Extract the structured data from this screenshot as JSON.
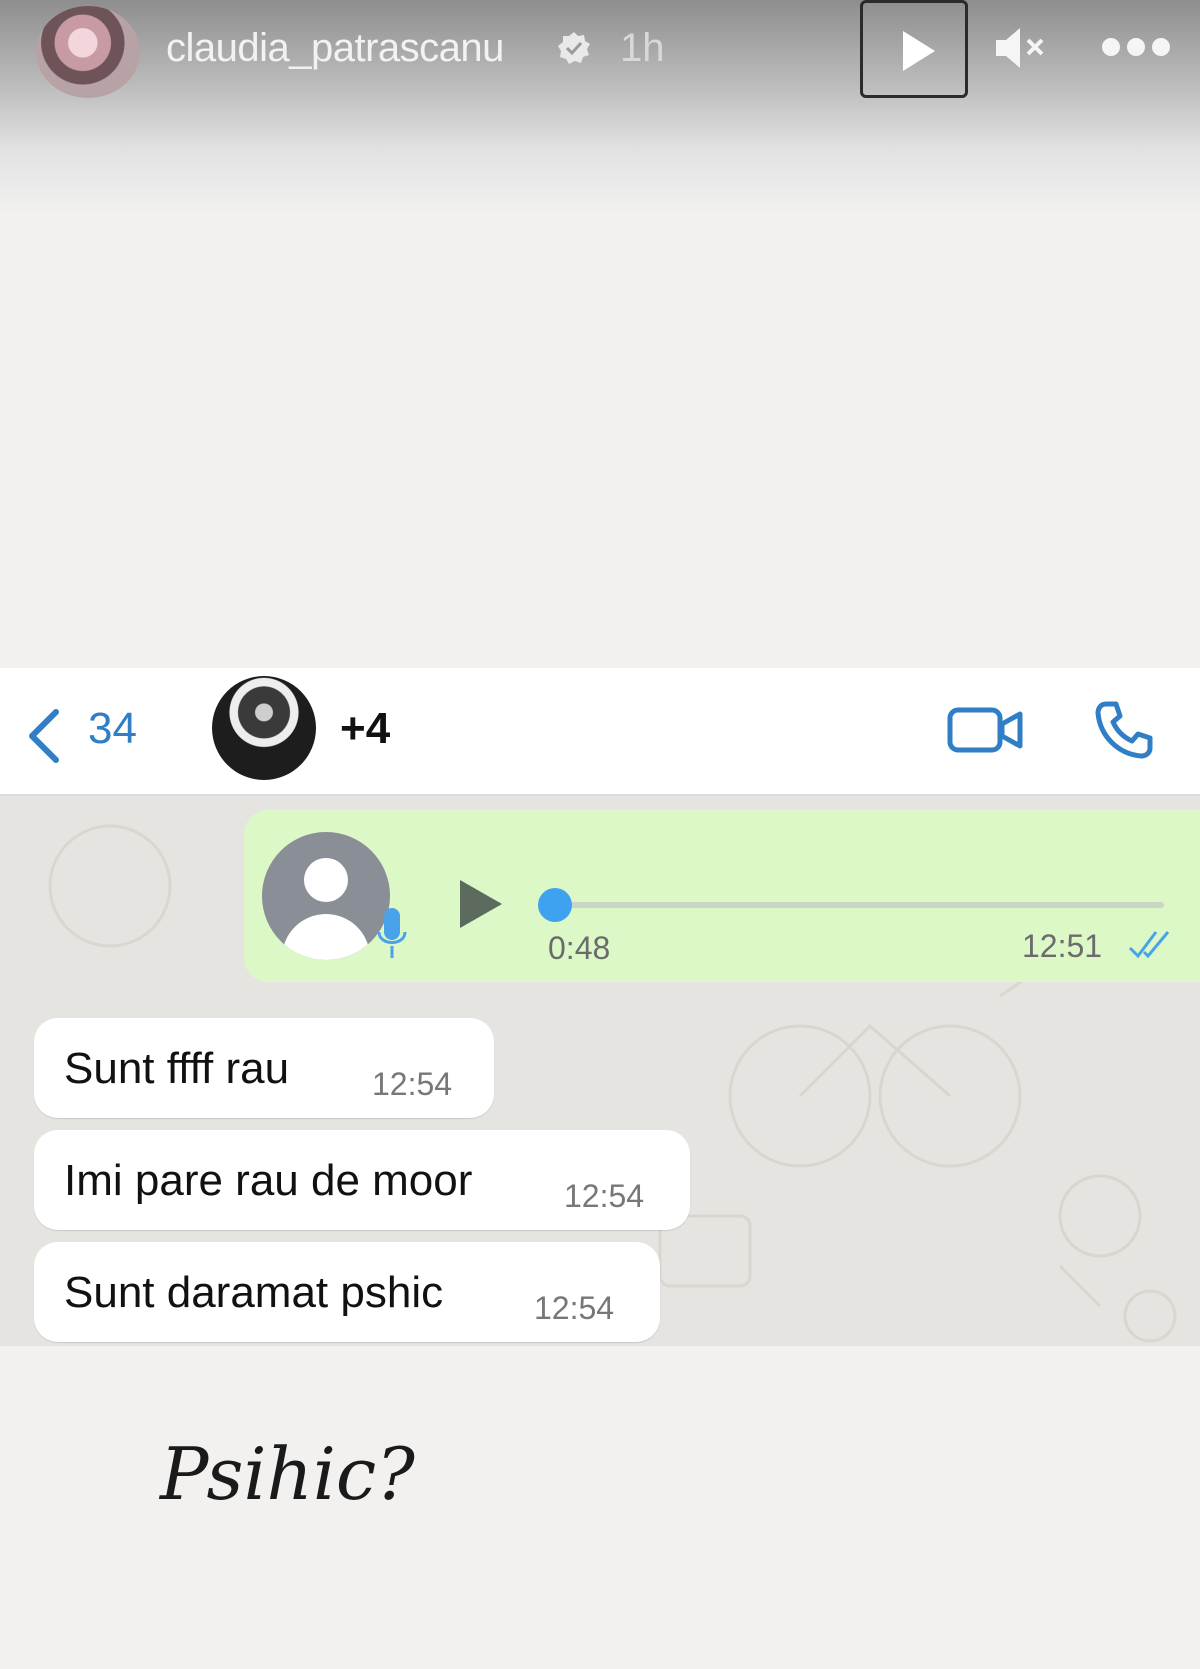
{
  "story": {
    "username": "claudia_patrascanu",
    "time_ago": "1h",
    "icons": [
      "verified-icon",
      "play-icon",
      "mute-icon",
      "more-icon"
    ]
  },
  "whatsapp": {
    "back_count": "34",
    "contact_name": "+4",
    "icons": [
      "back-chevron-icon",
      "video-call-icon",
      "phone-call-icon"
    ],
    "accent_color": "#2f7ec6",
    "voice_message": {
      "duration": "0:48",
      "time": "12:51",
      "progress": 0,
      "bubble_color": "#dbf8c6"
    },
    "messages": [
      {
        "text": "Sunt ffff rau",
        "time": "12:54"
      },
      {
        "text": "Imi pare rau de moor",
        "time": "12:54"
      },
      {
        "text": "Sunt daramat pshic",
        "time": "12:54"
      }
    ]
  },
  "caption": "Psihic?"
}
